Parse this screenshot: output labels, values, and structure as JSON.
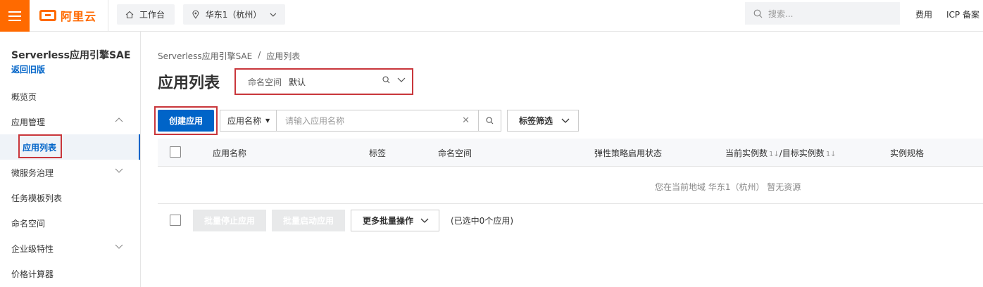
{
  "topbar": {
    "logo_text": "阿里云",
    "workbench_label": "工作台",
    "region_label": "华东1（杭州）",
    "search_placeholder": "搜索...",
    "links": [
      "费用",
      "ICP 备案"
    ],
    "brand_color": "#ff6a00"
  },
  "sidebar": {
    "product_title": "Serverless应用引擎SAE",
    "back_link": "返回旧版",
    "items": [
      {
        "label": "概览页",
        "expandable": false
      },
      {
        "label": "应用管理",
        "expandable": true,
        "expanded": true
      },
      {
        "label": "应用列表",
        "active": true
      },
      {
        "label": "微服务治理",
        "expandable": true
      },
      {
        "label": "任务模板列表",
        "expandable": false
      },
      {
        "label": "命名空间",
        "expandable": false
      },
      {
        "label": "企业级特性",
        "expandable": true
      },
      {
        "label": "价格计算器",
        "expandable": false
      }
    ]
  },
  "main": {
    "breadcrumb": [
      "Serverless应用引擎SAE",
      "/",
      "应用列表"
    ],
    "title": "应用列表",
    "namespace": {
      "label": "命名空间",
      "value": "默认"
    },
    "create_button": "创建应用",
    "filter": {
      "key": "应用名称",
      "placeholder": "请输入应用名称"
    },
    "tag_filter": "标签筛选",
    "table": {
      "columns": [
        "应用名称",
        "标签",
        "命名空间",
        "弹性策略启用状态",
        "当前实例数",
        "/目标实例数",
        "实例规格"
      ],
      "empty_text": "您在当前地域 华东1（杭州） 暂无资源"
    },
    "batch": {
      "stop": "批量停止应用",
      "start": "批量启动应用",
      "more": "更多批量操作",
      "selected_info": "(已选中0个应用)"
    },
    "accent_color": "#0064c8",
    "highlight_color": "#c9363b"
  }
}
